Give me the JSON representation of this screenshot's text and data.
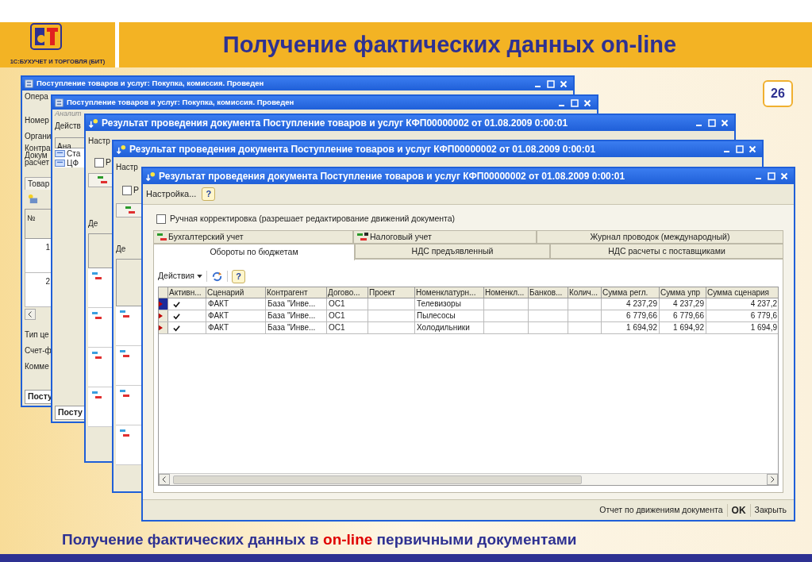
{
  "slide": {
    "logo_caption": "1С:БУХУЧЕТ И ТОРГОВЛЯ (БИТ)",
    "title": "Получение фактических данных on-line",
    "page_number": "26",
    "caption": [
      {
        "text": "Получение фактических данных в ",
        "highlight": false
      },
      {
        "text": "on-line",
        "highlight": true
      },
      {
        "text": " первичными документами",
        "highlight": false
      }
    ]
  },
  "back_windows": [
    {
      "title": "Поступление товаров и услуг: Покупка, комиссия. Проведен",
      "items": [
        {
          "kind": "toolbar",
          "text": "Опера"
        },
        {
          "kind": "label",
          "text": "Номер"
        },
        {
          "kind": "label",
          "text": "Органи"
        },
        {
          "kind": "label",
          "text": "Контра"
        },
        {
          "kind": "label",
          "text": "Докум"
        },
        {
          "kind": "label",
          "text": "расчет"
        },
        {
          "kind": "tab",
          "text": "Товар"
        },
        {
          "kind": "icon"
        },
        {
          "kind": "header",
          "text": "№"
        },
        {
          "kind": "number",
          "text": "1"
        },
        {
          "kind": "number",
          "text": "2"
        },
        {
          "kind": "scroll"
        },
        {
          "kind": "label",
          "text": "Тип це"
        },
        {
          "kind": "label",
          "text": "Счет-ф"
        },
        {
          "kind": "label",
          "text": "Комме"
        },
        {
          "kind": "bottom_tab",
          "text": "Посту"
        }
      ]
    },
    {
      "title": "Поступление товаров и услуг: Покупка, комиссия. Проведен",
      "items": [
        {
          "kind": "subtab",
          "text": "Аналит"
        },
        {
          "kind": "toolbar",
          "text": "Действ"
        },
        {
          "kind": "header",
          "text": "Ана"
        },
        {
          "kind": "row",
          "text": "Ста"
        },
        {
          "kind": "row",
          "text": "ЦФ"
        },
        {
          "kind": "bottom_tab",
          "text": "Посту"
        }
      ]
    },
    {
      "title": "Результат проведения документа Поступление товаров и услуг КФП00000002 от 01.08.2009 0:00:01",
      "items": [
        {
          "kind": "toolbar",
          "text": "Настр"
        },
        {
          "kind": "checkbox",
          "text": "Р",
          "checked": false
        },
        {
          "kind": "ledger_tab"
        },
        {
          "kind": "toolbar",
          "text": "Де"
        },
        {
          "kind": "header"
        },
        {
          "kind": "ledger_row"
        },
        {
          "kind": "ledger_row"
        },
        {
          "kind": "ledger_row"
        },
        {
          "kind": "ledger_row"
        }
      ]
    },
    {
      "title": "Результат проведения документа Поступление товаров и услуг КФП00000002 от 01.08.2009 0:00:01",
      "items": [
        {
          "kind": "toolbar",
          "text": "Настр"
        },
        {
          "kind": "checkbox",
          "text": "Р",
          "checked": false
        },
        {
          "kind": "ledger_tab"
        },
        {
          "kind": "toolbar",
          "text": "Де"
        },
        {
          "kind": "header"
        },
        {
          "kind": "ledger_row"
        },
        {
          "kind": "ledger_row"
        },
        {
          "kind": "ledger_row"
        },
        {
          "kind": "ledger_row"
        }
      ]
    }
  ],
  "window": {
    "title": "Результат проведения документа Поступление товаров и услуг КФП00000002 от 01.08.2009 0:00:01",
    "settings_label": "Настройка...",
    "help_label": "?",
    "manual_edit": {
      "label": "Ручная корректировка (разрешает редактирование движений документа)",
      "checked": false
    },
    "tab_rows": [
      [
        {
          "label": "Бухгалтерский учет",
          "kind": "ledger",
          "selected": false
        },
        {
          "label": "Налоговый учет",
          "kind": "ledger_tax",
          "selected": false
        },
        {
          "label": "Журнал проводок (международный)",
          "kind": "plain",
          "selected": false
        }
      ],
      [
        {
          "label": "Обороты по бюджетам",
          "kind": "plain",
          "selected": true
        },
        {
          "label": "НДС предъявленный",
          "kind": "plain",
          "selected": false
        },
        {
          "label": "НДС расчеты с поставщиками",
          "kind": "plain",
          "selected": false
        }
      ]
    ],
    "table_toolbar": {
      "actions_label": "Действия",
      "help_label": "?"
    },
    "table": {
      "columns": [
        {
          "kind": "check",
          "label": "Активн..."
        },
        {
          "kind": "text",
          "label": "Сценарий"
        },
        {
          "kind": "text",
          "label": "Контрагент"
        },
        {
          "kind": "text",
          "label": "Догово..."
        },
        {
          "kind": "text",
          "label": "Проект"
        },
        {
          "kind": "text",
          "label": "Номенклатурн..."
        },
        {
          "kind": "text",
          "label": "Номенкл..."
        },
        {
          "kind": "text",
          "label": "Банков..."
        },
        {
          "kind": "text",
          "label": "Колич..."
        },
        {
          "kind": "number",
          "label": "Сумма регл."
        },
        {
          "kind": "number",
          "label": "Сумма упр"
        },
        {
          "kind": "number",
          "label": "Сумма сценария"
        }
      ],
      "rows": [
        {
          "selected": true,
          "active": true,
          "cells": [
            "",
            "ФАКТ",
            "База \"Инве...",
            "ОС1",
            "",
            "Телевизоры",
            "",
            "",
            "",
            "4 237,29",
            "4 237,29",
            "4 237,2"
          ]
        },
        {
          "selected": false,
          "active": true,
          "cells": [
            "",
            "ФАКТ",
            "База \"Инве...",
            "ОС1",
            "",
            "Пылесосы",
            "",
            "",
            "",
            "6 779,66",
            "6 779,66",
            "6 779,6"
          ]
        },
        {
          "selected": false,
          "active": true,
          "cells": [
            "",
            "ФАКТ",
            "База \"Инве...",
            "ОС1",
            "",
            "Холодильники",
            "",
            "",
            "",
            "1 694,92",
            "1 694,92",
            "1 694,9"
          ]
        }
      ]
    },
    "buttons": [
      {
        "label": "Отчет по движениям документа",
        "default": false
      },
      {
        "label": "OK",
        "default": true
      },
      {
        "label": "Закрыть",
        "default": false
      }
    ]
  }
}
